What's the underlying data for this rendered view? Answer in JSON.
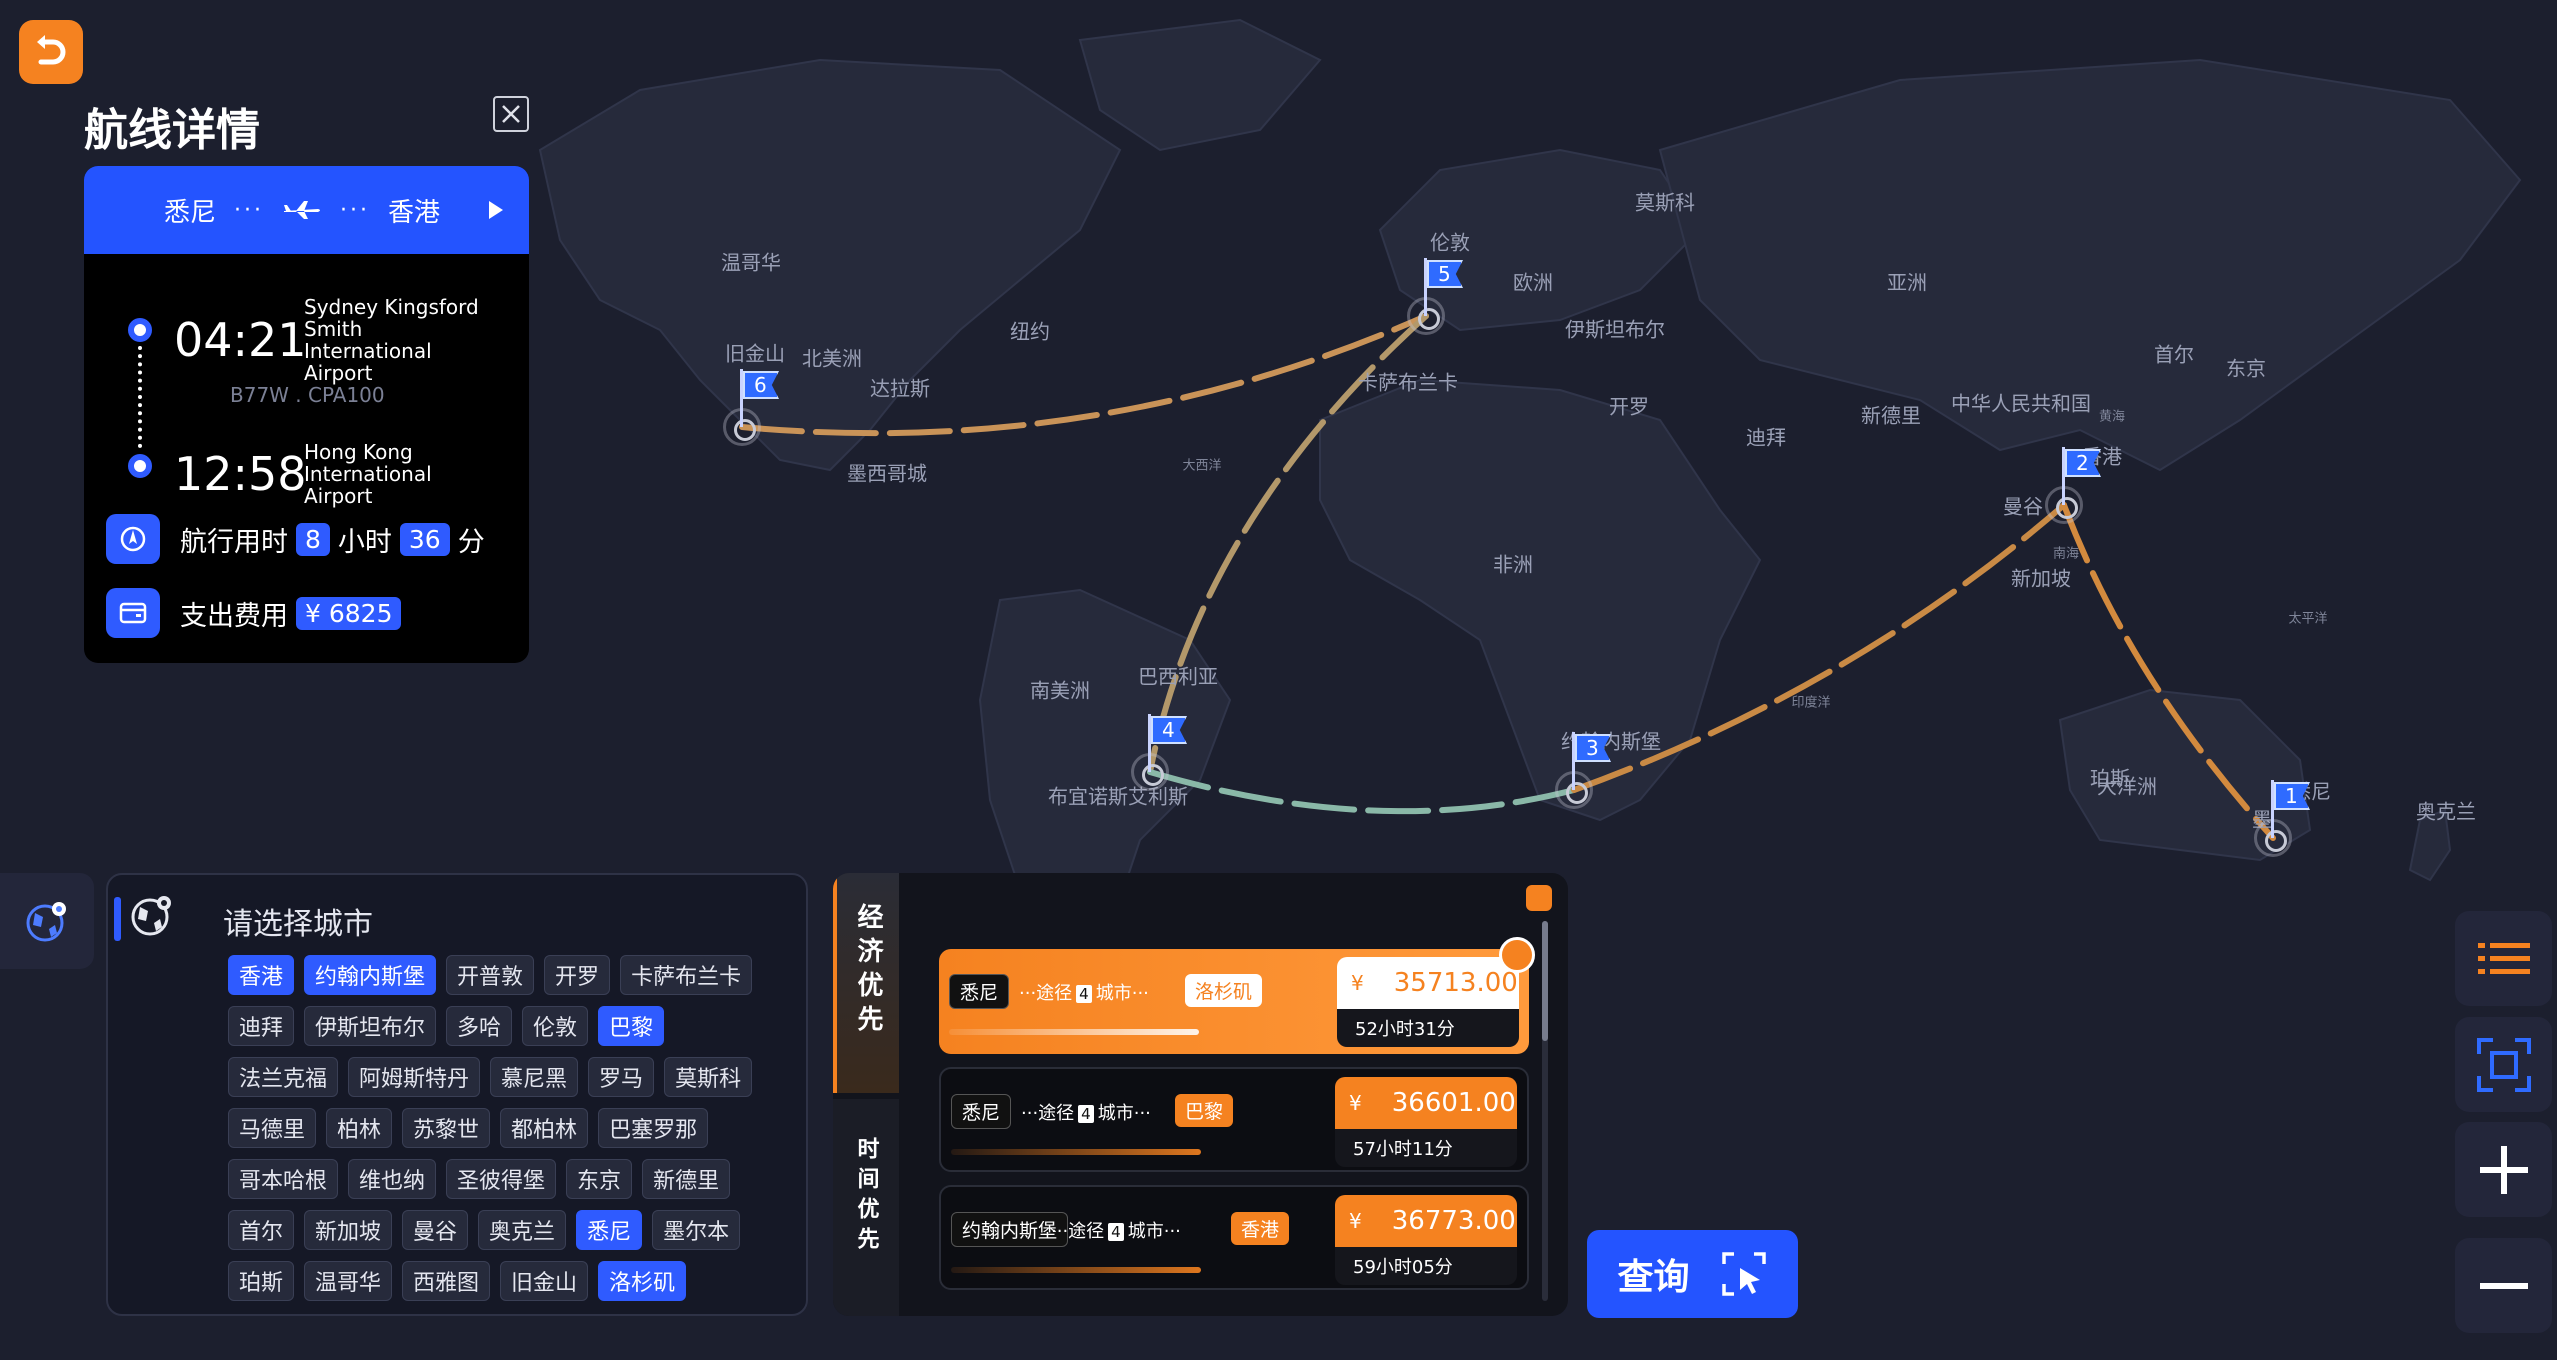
{
  "panel": {
    "title": "航线详情",
    "route": {
      "from": "悉尼",
      "to": "香港"
    },
    "departure": {
      "time": "04:21",
      "airport": "Sydney Kingsford Smith International Airport"
    },
    "flight_code": "B77W . CPA100",
    "arrival": {
      "time": "12:58",
      "airport": "Hong Kong International Airport"
    },
    "duration": {
      "label": "航行用时",
      "hours": "8",
      "hours_unit": "小时",
      "minutes": "36",
      "minutes_unit": "分"
    },
    "cost": {
      "label": "支出费用",
      "value": "¥  6825"
    }
  },
  "map_labels": {
    "large": [
      "莫斯科",
      "伦敦",
      "欧洲",
      "亚洲",
      "温哥华",
      "旧金山",
      "北美洲",
      "纽约",
      "达拉斯",
      "墨西哥城",
      "伊斯坦布尔",
      "首尔",
      "东京",
      "卡萨布兰卡",
      "开罗",
      "中华人民共和国",
      "迪拜",
      "新德里",
      "香港",
      "曼谷",
      "新加坡",
      "非洲",
      "巴西利亚",
      "南美洲",
      "布宜诺斯艾利斯",
      "约翰内斯堡",
      "珀斯",
      "大洋洲",
      "悉尼",
      "奥克兰",
      "墨"
    ],
    "small": [
      "大西洋",
      "黄海",
      "南海",
      "太平洋",
      "印度洋"
    ]
  },
  "flags": [
    "1",
    "2",
    "3",
    "4",
    "5",
    "6"
  ],
  "city_select": {
    "title": "请选择城市",
    "rows": [
      [
        {
          "name": "香港",
          "selected": true
        },
        {
          "name": "约翰内斯堡",
          "selected": true
        },
        {
          "name": "开普敦",
          "selected": false
        },
        {
          "name": "开罗",
          "selected": false
        },
        {
          "name": "卡萨布兰卡",
          "selected": false
        }
      ],
      [
        {
          "name": "迪拜",
          "selected": false
        },
        {
          "name": "伊斯坦布尔",
          "selected": false
        },
        {
          "name": "多哈",
          "selected": false
        },
        {
          "name": "伦敦",
          "selected": false
        },
        {
          "name": "巴黎",
          "selected": true
        }
      ],
      [
        {
          "name": "法兰克福",
          "selected": false
        },
        {
          "name": "阿姆斯特丹",
          "selected": false
        },
        {
          "name": "慕尼黑",
          "selected": false
        },
        {
          "name": "罗马",
          "selected": false
        },
        {
          "name": "莫斯科",
          "selected": false
        }
      ],
      [
        {
          "name": "马德里",
          "selected": false
        },
        {
          "name": "柏林",
          "selected": false
        },
        {
          "name": "苏黎世",
          "selected": false
        },
        {
          "name": "都柏林",
          "selected": false
        },
        {
          "name": "巴塞罗那",
          "selected": false
        }
      ],
      [
        {
          "name": "哥本哈根",
          "selected": false
        },
        {
          "name": "维也纳",
          "selected": false
        },
        {
          "name": "圣彼得堡",
          "selected": false
        },
        {
          "name": "东京",
          "selected": false
        },
        {
          "name": "新德里",
          "selected": false
        }
      ],
      [
        {
          "name": "首尔",
          "selected": false
        },
        {
          "name": "新加坡",
          "selected": false
        },
        {
          "name": "曼谷",
          "selected": false
        },
        {
          "name": "奥克兰",
          "selected": false
        },
        {
          "name": "悉尼",
          "selected": true
        },
        {
          "name": "墨尔本",
          "selected": false
        }
      ],
      [
        {
          "name": "珀斯",
          "selected": false
        },
        {
          "name": "温哥华",
          "selected": false
        },
        {
          "name": "西雅图",
          "selected": false
        },
        {
          "name": "旧金山",
          "selected": false
        },
        {
          "name": "洛杉矶",
          "selected": true
        }
      ]
    ]
  },
  "results": {
    "tab_economy": "经济优先",
    "tab_time": "时间优先",
    "options": [
      {
        "from": "悉尼",
        "via_prefix": "···途径",
        "via_count": "4",
        "via_suffix": "城市···",
        "to": "洛杉矶",
        "price": "35713.00",
        "duration": "52小时31分",
        "best": true
      },
      {
        "from": "悉尼",
        "via_prefix": "···途径",
        "via_count": "4",
        "via_suffix": "城市···",
        "to": "巴黎",
        "price": "36601.00",
        "duration": "57小时11分",
        "best": false
      },
      {
        "from": "约翰内斯堡",
        "via_prefix": "···途径",
        "via_count": "4",
        "via_suffix": "城市···",
        "to": "香港",
        "price": "36773.00",
        "duration": "59小时05分",
        "best": false
      }
    ],
    "currency": "¥"
  },
  "query_button": "查询",
  "colors": {
    "accent": "#2454ff",
    "orange": "#f58220",
    "background": "#1c1f2e"
  }
}
